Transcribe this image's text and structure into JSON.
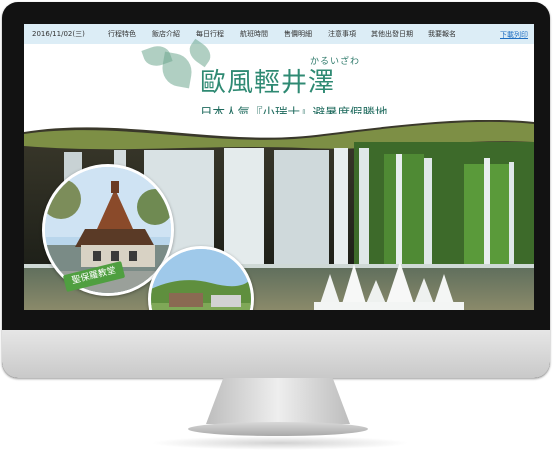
{
  "nav": {
    "date": "2016/11/02(三)",
    "items": [
      "行程特色",
      "飯店介紹",
      "每日行程",
      "航班時間",
      "售價明細",
      "注意事項",
      "其他出發日期",
      "我要報名"
    ],
    "download": "下載列印"
  },
  "header": {
    "kana": "かるいざわ",
    "title": "歐風輕井澤",
    "subtitle": "日本人氣『小瑞士』避暑度假勝地"
  },
  "photo": {
    "church_caption": "聖保羅教堂"
  },
  "colors": {
    "title_green": "#2f8a73",
    "nav_bg": "#dcedf6",
    "caption_bg": "#4f9f40"
  }
}
